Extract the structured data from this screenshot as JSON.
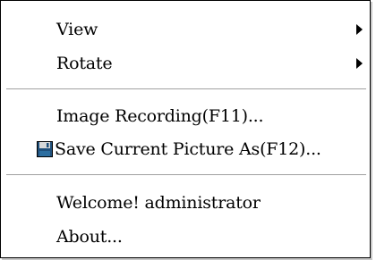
{
  "menu": {
    "items": [
      {
        "label": "View",
        "submenu": true
      },
      {
        "label": "Rotate",
        "submenu": true
      },
      {
        "label": "Image Recording(F11)...",
        "submenu": false
      },
      {
        "label": "Save Current Picture As(F12)...",
        "submenu": false,
        "icon": "floppy-disk-icon"
      },
      {
        "label": "Welcome! administrator",
        "submenu": false
      },
      {
        "label": "About...",
        "submenu": false
      }
    ]
  },
  "colors": {
    "text": "#000000",
    "background": "#ffffff",
    "separator": "#a0a0a0",
    "icon_body": "#1f4f7a"
  }
}
